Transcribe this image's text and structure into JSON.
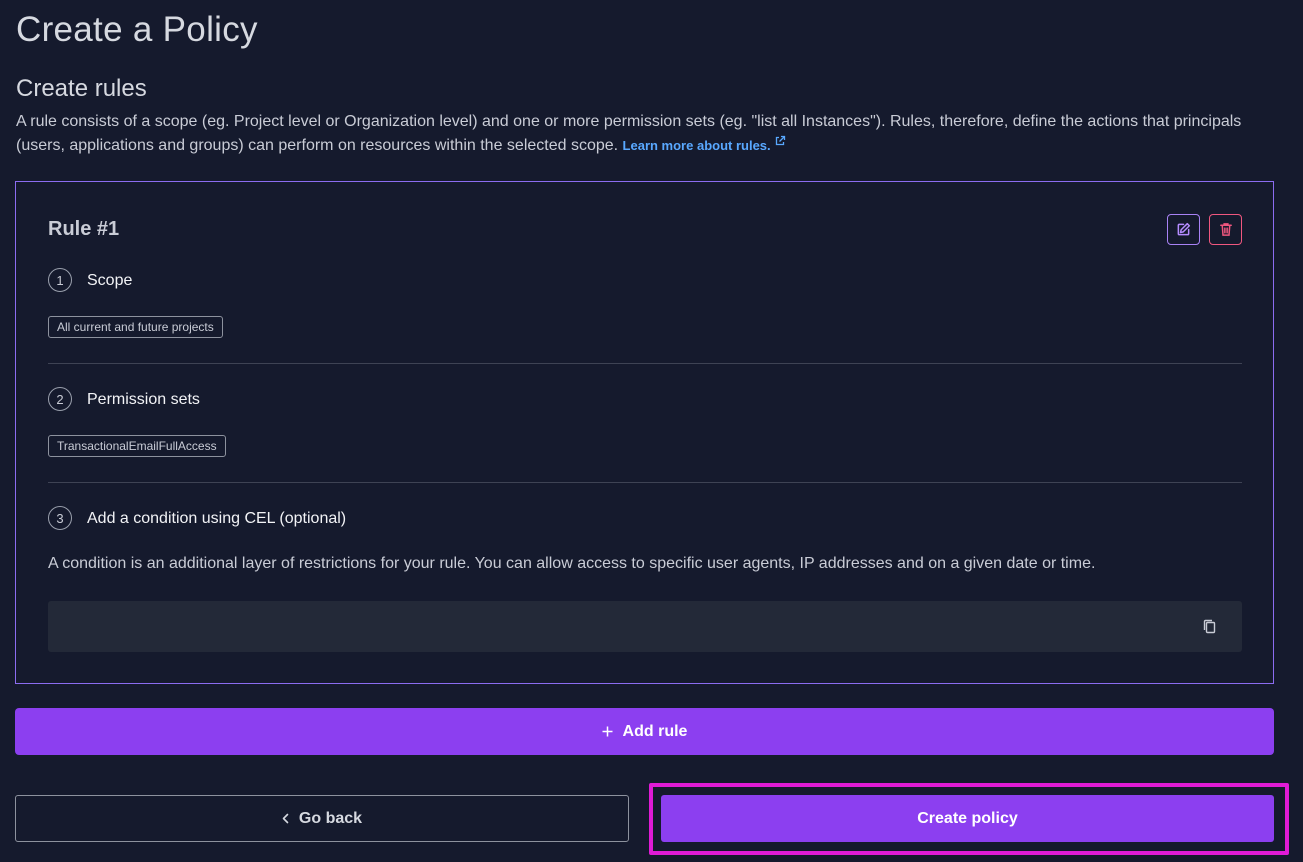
{
  "page": {
    "title": "Create a Policy"
  },
  "rules_section": {
    "title": "Create rules",
    "description": "A rule consists of a scope (eg. Project level or Organization level) and one or more permission sets (eg. \"list all Instances\"). Rules, therefore, define the actions that principals (users, applications and groups) can perform on resources within the selected scope.",
    "learn_more": "Learn more about rules."
  },
  "rule": {
    "title": "Rule #1",
    "steps": [
      {
        "number": "1",
        "label": "Scope",
        "tag": "All current and future projects"
      },
      {
        "number": "2",
        "label": "Permission sets",
        "tag": "TransactionalEmailFullAccess"
      },
      {
        "number": "3",
        "label": "Add a condition using CEL (optional)"
      }
    ],
    "condition_description": "A condition is an additional layer of restrictions for your rule. You can allow access to specific user agents, IP addresses and on a given date or time.",
    "condition_value": ""
  },
  "actions": {
    "add_rule": "Add rule",
    "go_back": "Go back",
    "create_policy": "Create policy"
  },
  "colors": {
    "background": "#151a2d",
    "accent": "#8c3ff0",
    "link": "#59a8ff",
    "danger": "#f0577f",
    "highlight": "#e01bd6"
  },
  "icons": [
    "external-link-icon",
    "edit-icon",
    "trash-icon",
    "copy-icon",
    "plus-icon",
    "chevron-left-icon"
  ]
}
